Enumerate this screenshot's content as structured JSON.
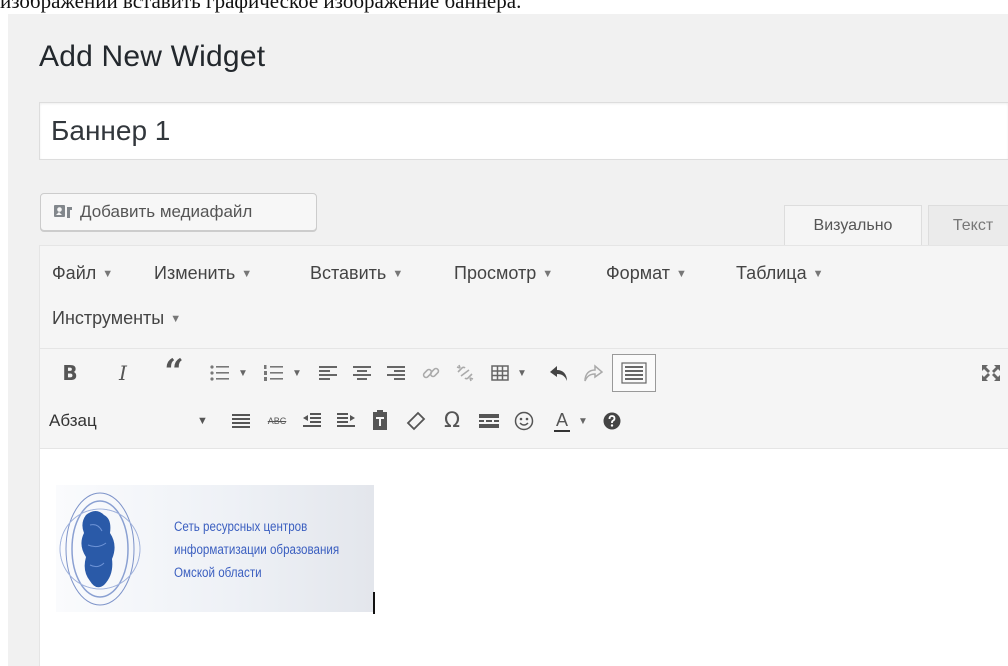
{
  "doc_line": "изображении вставить графическое изображение баннера.",
  "page": {
    "title": "Add New Widget"
  },
  "title_field": {
    "value": "Баннер 1"
  },
  "media_button": {
    "label": "Добавить медиафайл"
  },
  "tabs": {
    "visual": "Визуально",
    "text": "Текст"
  },
  "menus": [
    "Файл",
    "Изменить",
    "Вставить",
    "Просмотр",
    "Формат",
    "Таблица",
    "Инструменты"
  ],
  "toolbar": {
    "format_select": "Абзац",
    "icons_row1": [
      "bold-icon",
      "italic-icon",
      "blockquote-icon",
      "bullet-list-icon",
      "numbered-list-icon",
      "align-left-icon",
      "align-center-icon",
      "align-right-icon",
      "link-icon",
      "unlink-icon",
      "table-icon",
      "undo-icon",
      "redo-icon",
      "toolbar-toggle-icon",
      "fullscreen-icon"
    ],
    "icons_row2": [
      "format-select",
      "justify-icon",
      "strikethrough-icon",
      "outdent-icon",
      "indent-icon",
      "paste-text-icon",
      "clear-format-icon",
      "special-char-icon",
      "read-more-icon",
      "emoticon-icon",
      "text-color-icon",
      "help-icon"
    ],
    "bold_label": "B",
    "italic_label": "I",
    "blockquote_label": "“",
    "strike_label": "ABC",
    "omega_label": "Ω",
    "text_color_label": "A"
  },
  "banner": {
    "lines": [
      "Сеть ресурсных центров",
      "информатизации образования",
      "Омской области"
    ]
  },
  "colors": {
    "accent": "#3b5fc0",
    "background": "#f1f1f1",
    "toolbar": "#f5f5f5"
  }
}
